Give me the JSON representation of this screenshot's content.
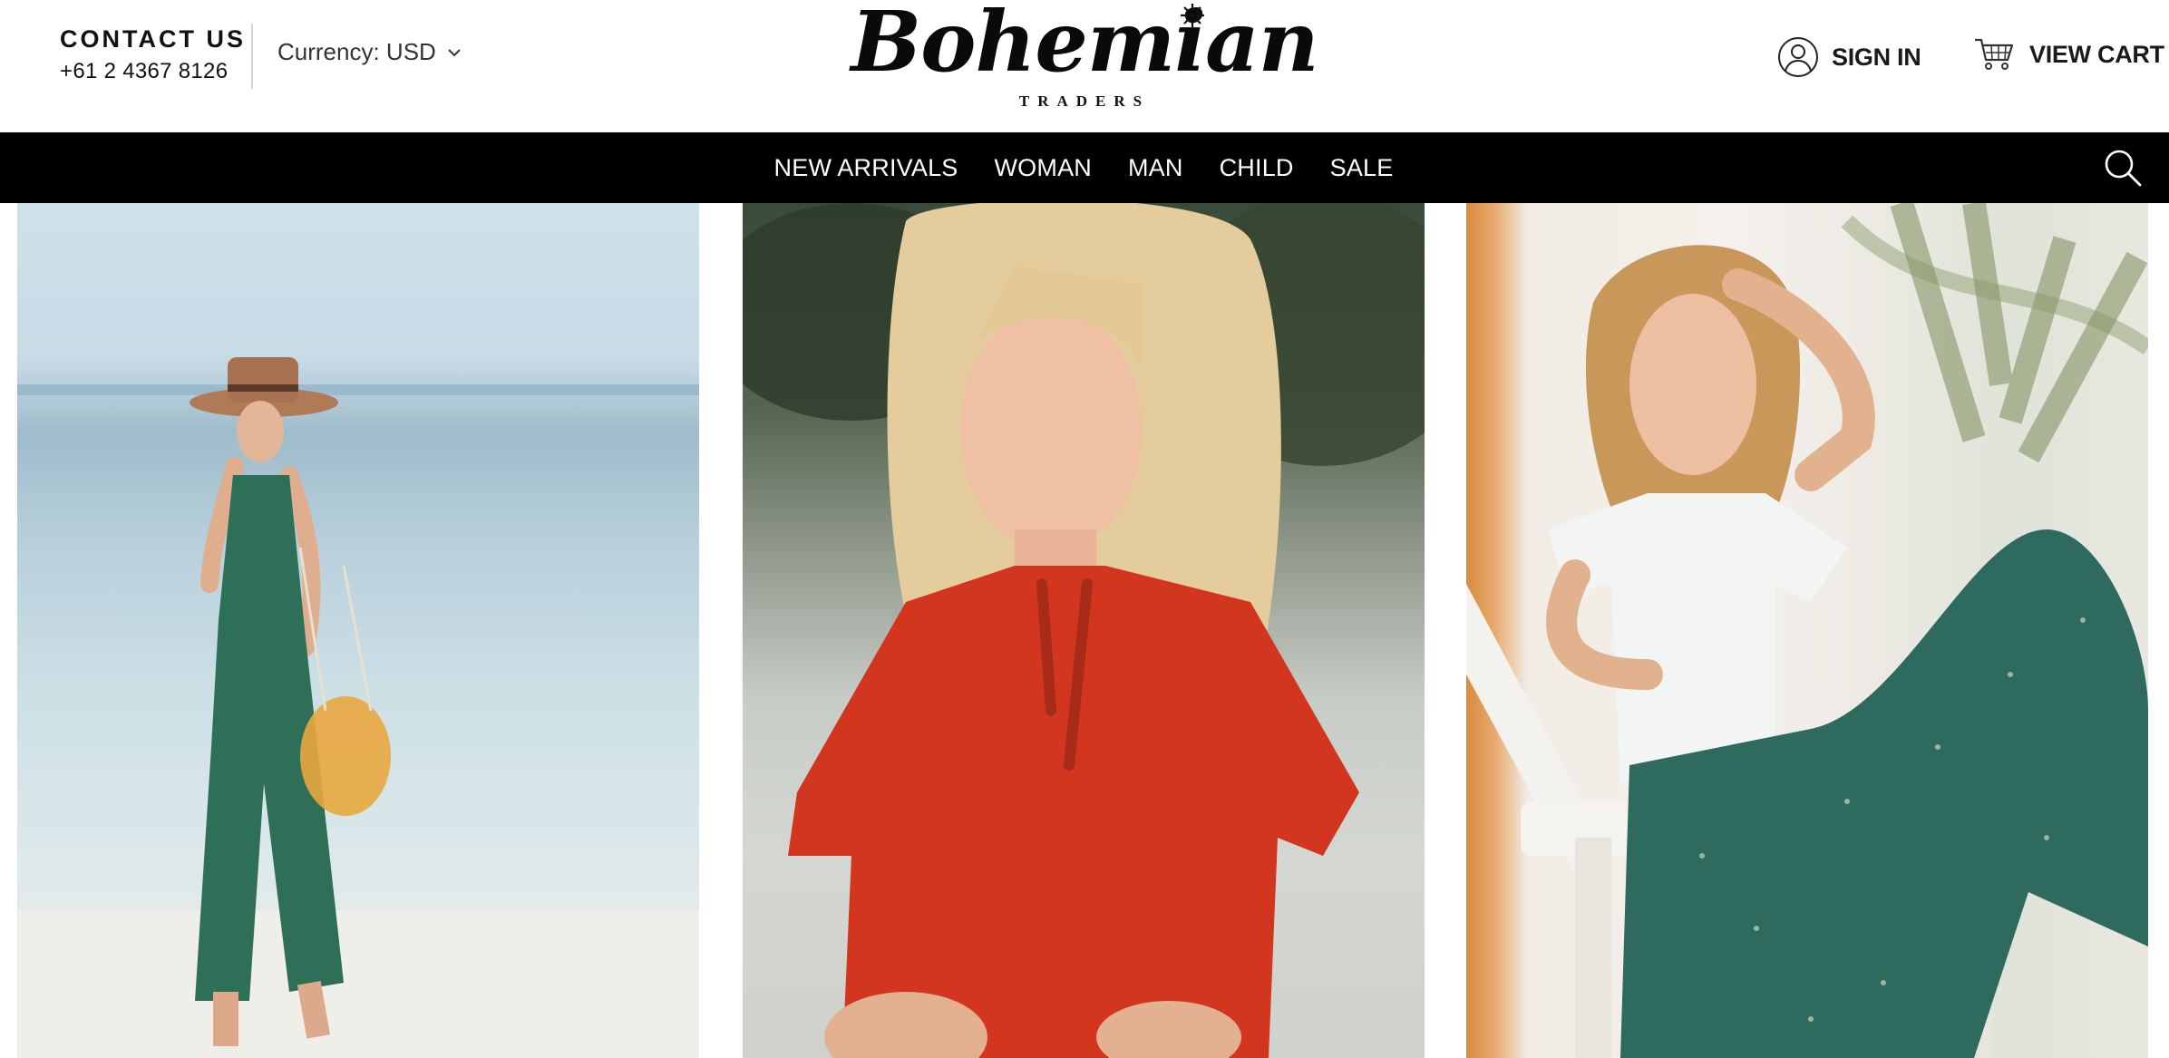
{
  "header": {
    "contact_title": "CONTACT US",
    "phone": "+61 2 4367 8126",
    "currency_label": "Currency: USD",
    "logo_text": "Bohemian",
    "logo_subtext": "TRADERS",
    "sign_in_label": "SIGN IN",
    "cart_label": "VIEW CART"
  },
  "nav": {
    "items": [
      {
        "label": "NEW ARRIVALS"
      },
      {
        "label": "WOMAN"
      },
      {
        "label": "MAN"
      },
      {
        "label": "CHILD"
      },
      {
        "label": "SALE"
      }
    ],
    "search_icon": "search-icon"
  },
  "hero": {
    "photos": [
      {
        "subject": "woman in green linen jumpsuit and straw hat on beach"
      },
      {
        "subject": "blonde woman in red tie-neck blouse"
      },
      {
        "subject": "woman in white tee and green floral pants on white chair"
      }
    ]
  },
  "colors": {
    "nav_background": "#000000",
    "nav_text": "#ffffff",
    "text_dark": "#111111",
    "divider": "#d6d6d6"
  }
}
